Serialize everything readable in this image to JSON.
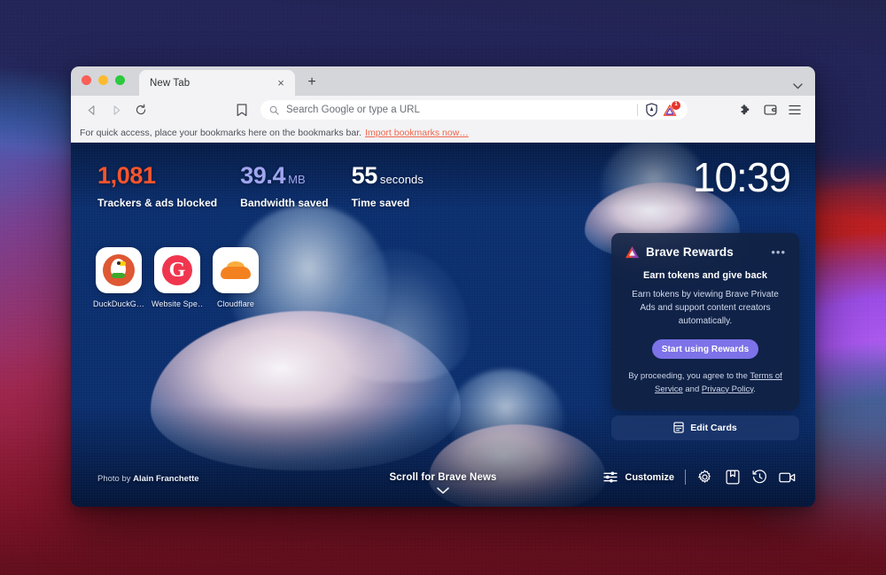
{
  "window": {
    "traffic_lights": [
      "close",
      "minimize",
      "maximize"
    ],
    "tab": {
      "title": "New Tab",
      "close_label": "×"
    },
    "new_tab_button": "+",
    "tabstrip_caret": "∨"
  },
  "toolbar": {
    "back_icon": "back-arrow-icon",
    "forward_icon": "forward-arrow-icon",
    "reload_icon": "reload-icon",
    "bookmark_icon": "bookmark-icon",
    "omnibox": {
      "placeholder": "Search Google or type a URL",
      "value": "",
      "search_icon": "search-icon"
    },
    "shields_icon": "brave-shields-icon",
    "rewards_icon": "brave-rewards-icon",
    "rewards_badge": "1",
    "extensions_icon": "puzzle-piece-icon",
    "wallet_icon": "brave-wallet-icon",
    "menu_icon": "hamburger-menu-icon"
  },
  "bookmarks_bar": {
    "message": "For quick access, place your bookmarks here on the bookmarks bar.",
    "import_link": "Import bookmarks now…"
  },
  "newtab": {
    "stats": [
      {
        "value": "1,081",
        "unit": "",
        "label": "Trackers & ads blocked",
        "color": "#fb542b"
      },
      {
        "value": "39.4",
        "unit": "MB",
        "label": "Bandwidth saved",
        "color": "#a0a5f0"
      },
      {
        "value": "55",
        "unit": "seconds",
        "label": "Time saved",
        "color": "#ffffff"
      }
    ],
    "clock": "10:39",
    "tiles": [
      {
        "label": "DuckDuckG…",
        "icon": "duckduckgo-icon"
      },
      {
        "label": "Website Spe…",
        "icon": "gtmetrix-icon"
      },
      {
        "label": "Cloudflare",
        "icon": "cloudflare-icon"
      }
    ],
    "rewards": {
      "icon": "brave-rewards-triangle-icon",
      "title": "Brave Rewards",
      "more_menu": "•••",
      "subtitle": "Earn tokens and give back",
      "body": "Earn tokens by viewing Brave Private Ads and support content creators automatically.",
      "cta": "Start using Rewards",
      "legal_prefix": "By proceeding, you agree to the ",
      "terms_link": "Terms of Service",
      "legal_mid": " and ",
      "privacy_link": "Privacy Policy",
      "legal_suffix": ".",
      "edit_cards": "Edit Cards",
      "edit_cards_icon": "cards-icon"
    },
    "photo_credit_prefix": "Photo by ",
    "photo_credit_author": "Alain Franchette",
    "scroll_news": "Scroll for Brave News",
    "scroll_caret": "∨",
    "customize": "Customize",
    "customize_icon": "sliders-icon",
    "tools": [
      {
        "icon": "settings-gear-icon",
        "name": "settings"
      },
      {
        "icon": "bookmarks-book-icon",
        "name": "bookmarks"
      },
      {
        "icon": "history-clock-icon",
        "name": "history"
      },
      {
        "icon": "brave-talk-video-icon",
        "name": "brave-talk"
      }
    ]
  },
  "colors": {
    "brave_orange": "#fb542b",
    "rewards_purple": "#7d72e8",
    "bandwidth_lavender": "#a0a5f0",
    "import_link": "#f0674d"
  }
}
